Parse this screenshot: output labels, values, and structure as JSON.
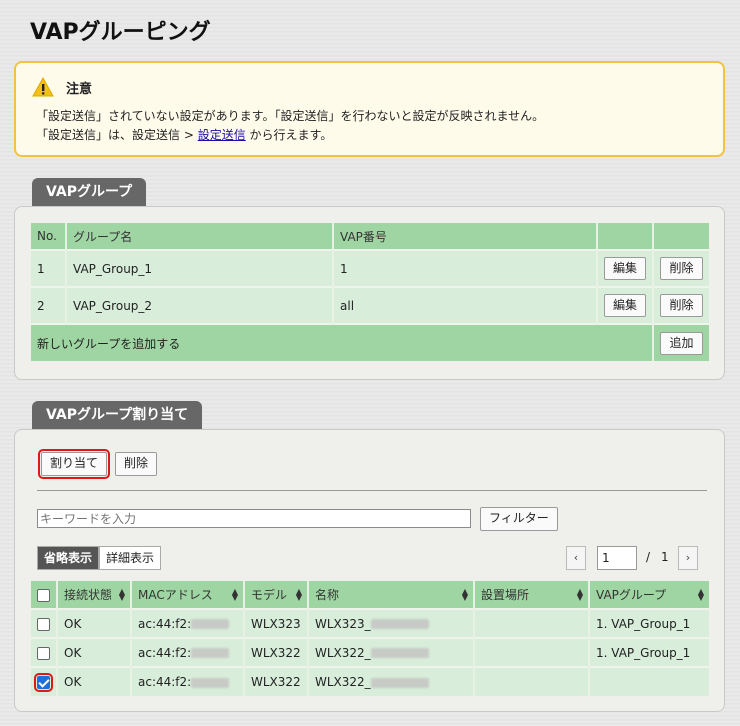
{
  "page": {
    "title": "VAPグルーピング"
  },
  "notice": {
    "title": "注意",
    "line1": "「設定送信」されていない設定があります。「設定送信」を行わないと設定が反映されません。",
    "line2_prefix": "「設定送信」は、設定送信 > ",
    "line2_link": "設定送信",
    "line2_suffix": " から行えます。",
    "icon": "warning-icon"
  },
  "vap_group": {
    "tab_label": "VAPグループ",
    "columns": [
      "No.",
      "グループ名",
      "VAP番号"
    ],
    "rows": [
      {
        "no": "1",
        "name": "VAP_Group_1",
        "vap": "1",
        "edit": "編集",
        "delete": "削除"
      },
      {
        "no": "2",
        "name": "VAP_Group_2",
        "vap": "all",
        "edit": "編集",
        "delete": "削除"
      }
    ],
    "add_row_label": "新しいグループを追加する",
    "add_button": "追加"
  },
  "assign": {
    "tab_label": "VAPグループ割り当て",
    "assign_button": "割り当て",
    "delete_button": "削除",
    "keyword_placeholder": "キーワードを入力",
    "filter_button": "フィルター",
    "view_short": "省略表示",
    "view_detail": "詳細表示",
    "pager": {
      "current": "1",
      "separator": "/",
      "total": "1",
      "prev": "‹",
      "next": "›"
    },
    "columns": [
      "接続状態",
      "MACアドレス",
      "モデル",
      "名称",
      "設置場所",
      "VAPグループ"
    ],
    "rows": [
      {
        "checked": false,
        "status": "OK",
        "mac": "ac:44:f2:",
        "model": "WLX323",
        "name": "WLX323_",
        "location": "",
        "group": "1. VAP_Group_1"
      },
      {
        "checked": false,
        "status": "OK",
        "mac": "ac:44:f2:",
        "model": "WLX322",
        "name": "WLX322_",
        "location": "",
        "group": "1. VAP_Group_1"
      },
      {
        "checked": true,
        "status": "OK",
        "mac": "ac:44:f2:",
        "model": "WLX322",
        "name": "WLX322_",
        "location": "",
        "group": ""
      }
    ]
  }
}
